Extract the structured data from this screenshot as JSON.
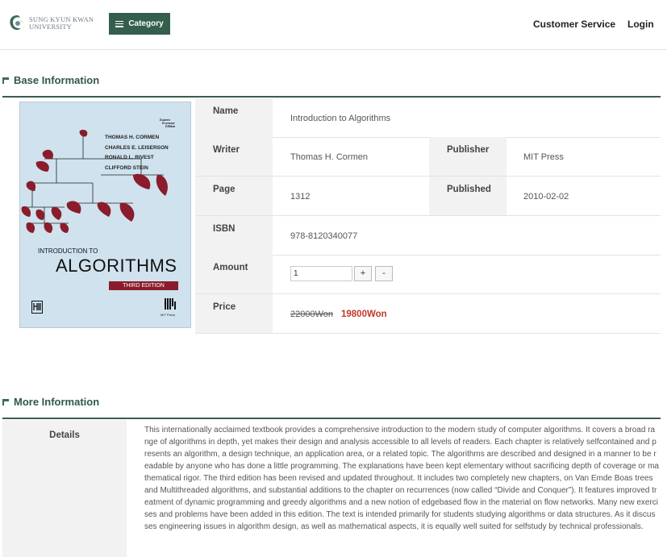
{
  "header": {
    "logo_text": "SUNG KYUN KWAN\nUNIVERSITY",
    "category_label": "Category",
    "customer_service": "Customer Service",
    "login": "Login"
  },
  "base": {
    "title": "Base Information",
    "cover": {
      "authors": [
        "THOMAS H. CORMEN",
        "CHARLES E. LEISERSON",
        "RONALD L. RIVEST",
        "CLIFFORD STEIN"
      ],
      "intro": "INTRODUCTION TO",
      "title": "ALGORITHMS",
      "edition": "THIRD EDITION",
      "publisher_mark": "PHI",
      "mit_press": "MIT Press"
    },
    "fields": {
      "name_label": "Name",
      "name_value": "Introduction to Algorithms",
      "writer_label": "Writer",
      "writer_value": "Thomas H. Cormen",
      "publisher_label": "Publisher",
      "publisher_value": "MIT Press",
      "page_label": "Page",
      "page_value": "1312",
      "published_label": "Published",
      "published_value": "2010-02-02",
      "isbn_label": "ISBN",
      "isbn_value": "978-8120340077",
      "amount_label": "Amount",
      "amount_value": "1",
      "plus": "+",
      "minus": "-",
      "price_label": "Price",
      "old_price": "22000Won",
      "new_price": "19800Won"
    }
  },
  "more": {
    "title": "More Information",
    "details_label": "Details",
    "details_text": "This internationally acclaimed textbook provides a comprehensive introduction to the modern study of computer algorithms. It covers a broad range of algorithms in depth, yet makes their design and analysis accessible to all levels of readers. Each chapter is relatively selfcontained and presents an algorithm, a design technique, an application area, or a related topic. The algorithms are described and designed in a manner to be readable by anyone who has done a little programming. The explanations have been kept elementary without sacrificing depth of coverage or mathematical rigor. The third edition has been revised and updated throughout. It includes two completely new chapters, on Van Emde Boas trees and Multithreaded algorithms, and substantial additions to the chapter on recurrences (now called “Divide and Conquer”). It features improved treatment of dynamic programming and greedy algorithms and a new notion of edgebased flow in the material on flow networks. Many new exercises and problems have been added in this edition. The text is intended primarily for students studying algorithms or data structures. As it discusses engineering issues in algorithm design, as well as mathematical aspects, it is equally well suited for selfstudy by technical professionals."
  },
  "colors": {
    "accent": "#355f4d",
    "price_red": "#c0392b",
    "cover_bg": "#cfe2ee",
    "mobile_red": "#8a1c2b"
  }
}
